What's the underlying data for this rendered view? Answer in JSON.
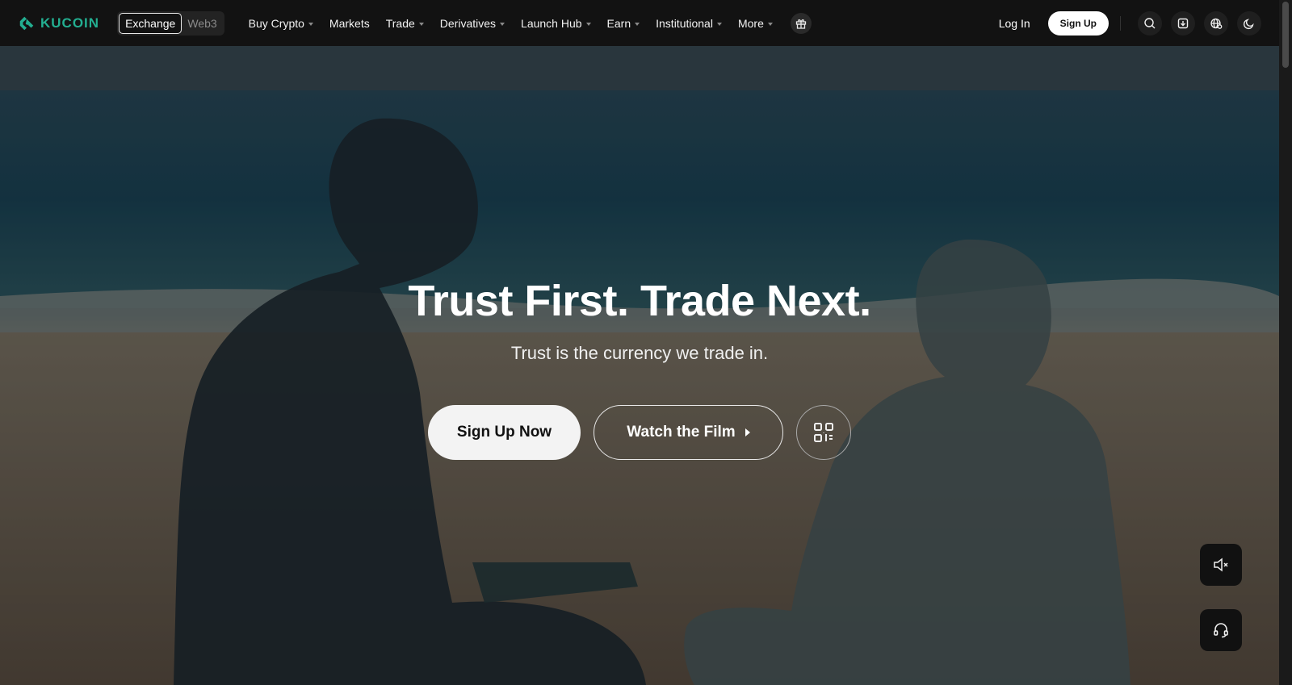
{
  "brand": {
    "name": "KUCOIN",
    "accent_color": "#23af91"
  },
  "mode_switch": {
    "options": [
      "Exchange",
      "Web3"
    ],
    "selected": "Exchange"
  },
  "nav": {
    "items": [
      {
        "label": "Buy Crypto",
        "dropdown": true
      },
      {
        "label": "Markets",
        "dropdown": false
      },
      {
        "label": "Trade",
        "dropdown": true
      },
      {
        "label": "Derivatives",
        "dropdown": true
      },
      {
        "label": "Launch Hub",
        "dropdown": true
      },
      {
        "label": "Earn",
        "dropdown": true
      },
      {
        "label": "Institutional",
        "dropdown": true
      },
      {
        "label": "More",
        "dropdown": true
      }
    ],
    "gift_icon": "gift-icon"
  },
  "header_right": {
    "login_label": "Log In",
    "signup_label": "Sign Up",
    "icons": [
      "search-icon",
      "download-icon",
      "globe-icon",
      "moon-icon"
    ]
  },
  "hero": {
    "title": "Trust First. Trade Next.",
    "subtitle": "Trust is the currency we trade in.",
    "primary_cta": "Sign Up Now",
    "secondary_cta": "Watch the Film",
    "qr_icon": "qr-code-icon"
  },
  "floating": {
    "mute_icon": "speaker-muted-icon",
    "support_icon": "headset-icon"
  }
}
